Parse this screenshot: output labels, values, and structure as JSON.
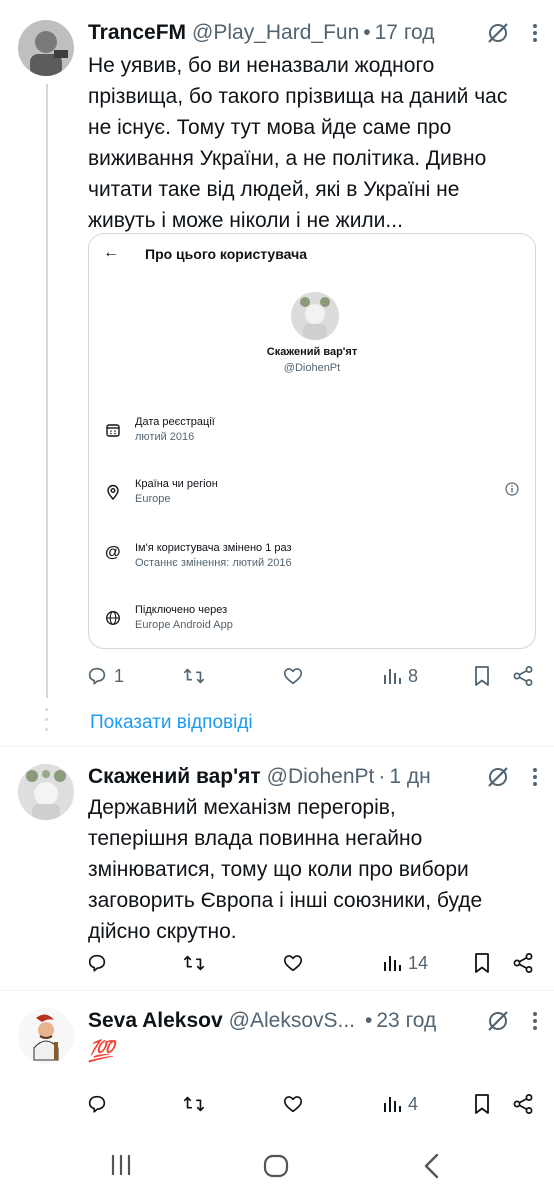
{
  "posts": [
    {
      "name": "TranceFM",
      "handle": "@Play_Hard_Fun",
      "sep": "•",
      "time": "17 год",
      "text_lines": [
        "Не уявив, бо ви неназвали жодного",
        "прізвища, бо такого прізвища на даний час",
        "не існує. Тому тут мова йде саме про",
        "виживання України, а не політика. Дивно",
        "читати таке від людей, які в Україні не",
        "живуть і може ніколи і не жили..."
      ],
      "replies": "1",
      "retweets": "",
      "likes": "",
      "views": "8"
    },
    {
      "name": "Скажений вар'ят",
      "handle": "@DiohenPt",
      "sep": "·",
      "time": "1 дн",
      "text_lines": [
        "Державний  механізм перегорів,",
        "теперішня влада повинна  негайно",
        "змінюватися, тому що коли про вибори",
        "заговорить Європа і інші союзники, буде",
        "дійсно  скрутно."
      ],
      "replies": "",
      "retweets": "",
      "likes": "",
      "views": "14"
    },
    {
      "name": "Seva Aleksov",
      "handle": "@AleksovS...",
      "sep": "•",
      "time": "23 год",
      "text": "💯",
      "replies": "",
      "retweets": "",
      "likes": "",
      "views": "4"
    }
  ],
  "card": {
    "title": "Про цього користувача",
    "name": "Скажений вар'ят",
    "handle": "@DiohenPt",
    "rows": [
      {
        "icon": "calendar-icon",
        "label": "Дата реєстрації",
        "value": "лютий 2016"
      },
      {
        "icon": "location-pin-icon",
        "label": "Країна чи регіон",
        "value": "Europe"
      },
      {
        "icon": "at-sign-icon",
        "label": "Ім'я користувача змінено 1 раз",
        "value": "Останнє змінення: лютий 2016"
      },
      {
        "icon": "globe-icon",
        "label": "Підключено через",
        "value": "Europe Android App"
      }
    ]
  },
  "show_replies": "Показати відповіді",
  "colors": {
    "accent": "#1d9bf0",
    "secondary_text": "#536471",
    "border": "#cfd9de"
  }
}
